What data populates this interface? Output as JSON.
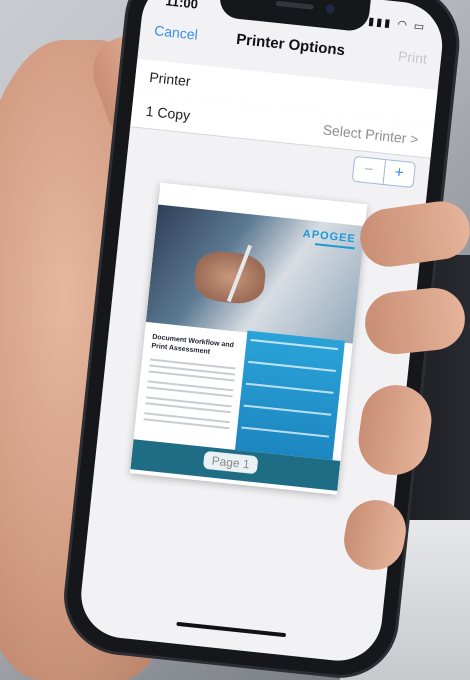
{
  "status_bar": {
    "time": "11:00",
    "icons": "signal-wifi-battery"
  },
  "nav": {
    "cancel_label": "Cancel",
    "title": "Printer Options",
    "print_label": "Print"
  },
  "rows": {
    "printer_label": "Printer",
    "printer_value": "Select Printer >",
    "copies_label": "1 Copy"
  },
  "stepper": {
    "minus": "−",
    "plus": "+"
  },
  "preview": {
    "brand": "APOGEE",
    "heading": "Document Workflow and Print Assessment",
    "page_label": "Page 1"
  }
}
